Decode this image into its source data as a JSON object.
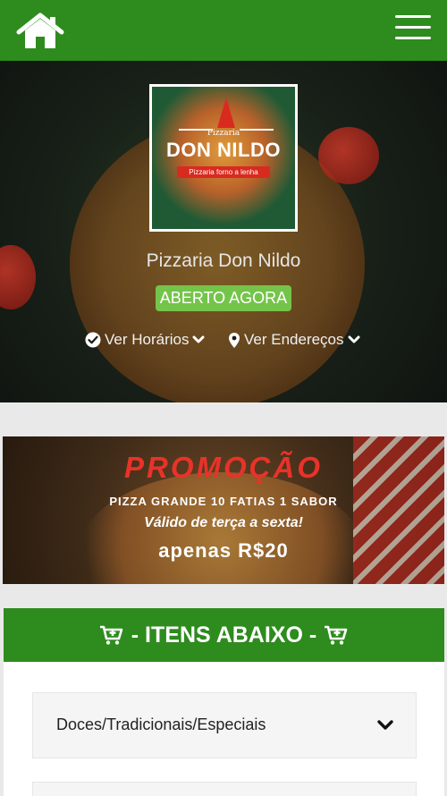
{
  "nav": {
    "home_icon": "home-icon",
    "menu_icon": "hamburger-menu-icon",
    "brand_color": "#2e8b1e"
  },
  "hero": {
    "logo": {
      "small_text": "Pizzaria",
      "brand": "DON NILDO",
      "ribbon": "Pizzaria forno a lenha"
    },
    "store_name": "Pizzaria Don Nildo",
    "status_badge": "ABERTO AGORA",
    "status_color": "#74c44a",
    "hours_link": "Ver Horários",
    "address_link": "Ver Endereços"
  },
  "promo": {
    "title": "PROMOÇÃO",
    "line1": "PIZZA GRANDE 10 FATIAS 1 SABOR",
    "line2": "Válido de terça a sexta!",
    "price": "apenas R$20"
  },
  "items": {
    "header": "- ITENS ABAIXO -",
    "categories": [
      {
        "label": "Doces/Tradicionais/Especiais"
      }
    ]
  }
}
